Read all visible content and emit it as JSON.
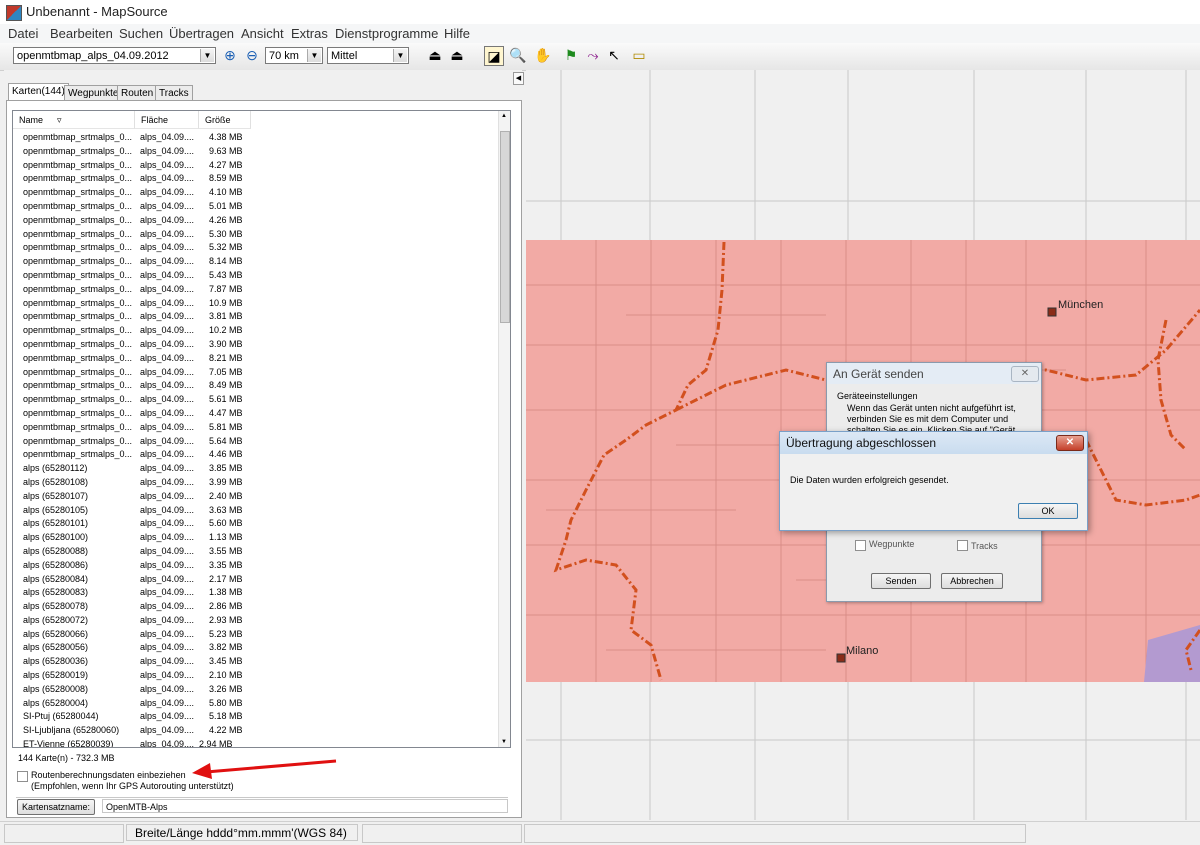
{
  "window": {
    "title": "Unbenannt - MapSource"
  },
  "menu": [
    "Datei",
    "Bearbeiten",
    "Suchen",
    "Übertragen",
    "Ansicht",
    "Extras",
    "Dienstprogramme",
    "Hilfe"
  ],
  "toolbar": {
    "map_product": "openmtbmap_alps_04.09.2012",
    "zoom_scale": "70 km",
    "detail_level": "Mittel"
  },
  "tabs": [
    "Karten(144)",
    "Wegpunkte",
    "Routen",
    "Tracks"
  ],
  "list": {
    "columns": [
      "Name",
      "Fläche",
      "Größe"
    ],
    "rows": [
      [
        "openmtbmap_srtmalps_0...",
        "alps_04.09....",
        "4.38 MB"
      ],
      [
        "openmtbmap_srtmalps_0...",
        "alps_04.09....",
        "9.63 MB"
      ],
      [
        "openmtbmap_srtmalps_0...",
        "alps_04.09....",
        "4.27 MB"
      ],
      [
        "openmtbmap_srtmalps_0...",
        "alps_04.09....",
        "8.59 MB"
      ],
      [
        "openmtbmap_srtmalps_0...",
        "alps_04.09....",
        "4.10 MB"
      ],
      [
        "openmtbmap_srtmalps_0...",
        "alps_04.09....",
        "5.01 MB"
      ],
      [
        "openmtbmap_srtmalps_0...",
        "alps_04.09....",
        "4.26 MB"
      ],
      [
        "openmtbmap_srtmalps_0...",
        "alps_04.09....",
        "5.30 MB"
      ],
      [
        "openmtbmap_srtmalps_0...",
        "alps_04.09....",
        "5.32 MB"
      ],
      [
        "openmtbmap_srtmalps_0...",
        "alps_04.09....",
        "8.14 MB"
      ],
      [
        "openmtbmap_srtmalps_0...",
        "alps_04.09....",
        "5.43 MB"
      ],
      [
        "openmtbmap_srtmalps_0...",
        "alps_04.09....",
        "7.87 MB"
      ],
      [
        "openmtbmap_srtmalps_0...",
        "alps_04.09....",
        "10.9 MB"
      ],
      [
        "openmtbmap_srtmalps_0...",
        "alps_04.09....",
        "3.81 MB"
      ],
      [
        "openmtbmap_srtmalps_0...",
        "alps_04.09....",
        "10.2 MB"
      ],
      [
        "openmtbmap_srtmalps_0...",
        "alps_04.09....",
        "3.90 MB"
      ],
      [
        "openmtbmap_srtmalps_0...",
        "alps_04.09....",
        "8.21 MB"
      ],
      [
        "openmtbmap_srtmalps_0...",
        "alps_04.09....",
        "7.05 MB"
      ],
      [
        "openmtbmap_srtmalps_0...",
        "alps_04.09....",
        "8.49 MB"
      ],
      [
        "openmtbmap_srtmalps_0...",
        "alps_04.09....",
        "5.61 MB"
      ],
      [
        "openmtbmap_srtmalps_0...",
        "alps_04.09....",
        "4.47 MB"
      ],
      [
        "openmtbmap_srtmalps_0...",
        "alps_04.09....",
        "5.81 MB"
      ],
      [
        "openmtbmap_srtmalps_0...",
        "alps_04.09....",
        "5.64 MB"
      ],
      [
        "openmtbmap_srtmalps_0...",
        "alps_04.09....",
        "4.46 MB"
      ],
      [
        "alps (65280112)",
        "alps_04.09....",
        "3.85 MB"
      ],
      [
        "alps (65280108)",
        "alps_04.09....",
        "3.99 MB"
      ],
      [
        "alps (65280107)",
        "alps_04.09....",
        "2.40 MB"
      ],
      [
        "alps (65280105)",
        "alps_04.09....",
        "3.63 MB"
      ],
      [
        "alps (65280101)",
        "alps_04.09....",
        "5.60 MB"
      ],
      [
        "alps (65280100)",
        "alps_04.09....",
        "1.13 MB"
      ],
      [
        "alps (65280088)",
        "alps_04.09....",
        "3.55 MB"
      ],
      [
        "alps (65280086)",
        "alps_04.09....",
        "3.35 MB"
      ],
      [
        "alps (65280084)",
        "alps_04.09....",
        "2.17 MB"
      ],
      [
        "alps (65280083)",
        "alps_04.09....",
        "1.38 MB"
      ],
      [
        "alps (65280078)",
        "alps_04.09....",
        "2.86 MB"
      ],
      [
        "alps (65280072)",
        "alps_04.09....",
        "2.93 MB"
      ],
      [
        "alps (65280066)",
        "alps_04.09....",
        "5.23 MB"
      ],
      [
        "alps (65280056)",
        "alps_04.09....",
        "3.82 MB"
      ],
      [
        "alps (65280036)",
        "alps_04.09....",
        "3.45 MB"
      ],
      [
        "alps (65280019)",
        "alps_04.09....",
        "2.10 MB"
      ],
      [
        "alps (65280008)",
        "alps_04.09....",
        "3.26 MB"
      ],
      [
        "alps (65280004)",
        "alps_04.09....",
        "5.80 MB"
      ],
      [
        "SI-Ptuj (65280044)",
        "alps_04.09....",
        "5.18 MB"
      ],
      [
        "SI-Ljubljana (65280060)",
        "alps_04.09....",
        "4.22 MB"
      ]
    ]
  },
  "summary": "144 Karte(n) - 732.3 MB",
  "routing": {
    "checkbox_label": "Routenberechnungsdaten einbeziehen",
    "hint": "(Empfohlen, wenn Ihr GPS Autorouting unterstützt)"
  },
  "mapset": {
    "button": "Kartensatzname:",
    "value": "OpenMTB-Alps"
  },
  "map": {
    "cities": [
      "München",
      "Milano"
    ]
  },
  "send_dialog": {
    "title": "An Gerät senden",
    "group": "Geräteeinstellungen",
    "text_line1": "Wenn das Gerät unten nicht aufgeführt ist,",
    "text_line2": "verbinden Sie es mit dem Computer und",
    "text_line3": "schalten Sie es ein. Klicken Sie auf \"Gerät",
    "waypoints": "Wegpunkte",
    "tracks": "Tracks",
    "send": "Senden",
    "cancel": "Abbrechen"
  },
  "done_dialog": {
    "title": "Übertragung abgeschlossen",
    "message": "Die Daten wurden erfolgreich gesendet.",
    "ok": "OK"
  },
  "status": {
    "coords_format": "Breite/Länge hddd°mm.mmm'(WGS 84)"
  },
  "colors": {
    "map_area": "#f2aaa5",
    "route": "#d2501e",
    "arrow": "#e01010"
  }
}
